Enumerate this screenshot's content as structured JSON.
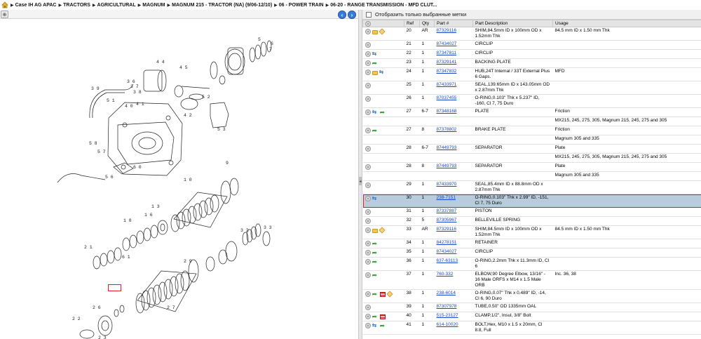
{
  "breadcrumb": [
    "Case IH AG APAC",
    "TRACTORS",
    "AGRICULTURAL",
    "MAGNUM",
    "MAGNUM 215 - TRACTOR (NA) (9/06-12/10)",
    "06 - POWER TRAIN",
    "06-20 - RANGE TRANSMISSION - MFD CLUT..."
  ],
  "filter": {
    "label": "Отобразить только выбранные метки",
    "checked": false
  },
  "columns": [
    "",
    "Ref",
    "Qty",
    "Part #",
    "Part Description",
    "Usage"
  ],
  "rows": [
    {
      "icons": [
        "gear-icon",
        "folder-icon",
        "box-icon"
      ],
      "ref": "20",
      "qty": "AR",
      "part": "87329116",
      "desc": "SHIM,84.5mm ID x 100mm OD x 1.52mm Thk",
      "usage": "84.5 mm ID x 1.50 mm Thk"
    },
    {
      "icons": [
        "gear-icon"
      ],
      "ref": "21",
      "qty": "1",
      "part": "87434027",
      "desc": "CIRCLIP",
      "usage": ""
    },
    {
      "icons": [
        "gear-icon",
        "swap-icon"
      ],
      "ref": "22",
      "qty": "1",
      "part": "87347811",
      "desc": "CIRCLIP",
      "usage": ""
    },
    {
      "icons": [
        "gear-icon",
        "arrow-icon"
      ],
      "ref": "23",
      "qty": "1",
      "part": "87329141",
      "desc": "BACKING PLATE",
      "usage": ""
    },
    {
      "icons": [
        "gear-icon",
        "folder-icon",
        "swap-icon"
      ],
      "ref": "24",
      "qty": "1",
      "part": "87347832",
      "desc": "HUB,24T Internal / 33T External Plus 6 Gaps.",
      "usage": "MFD"
    },
    {
      "icons": [
        "gear-icon"
      ],
      "ref": "25",
      "qty": "1",
      "part": "87433971",
      "desc": "SEAL,139.65mm ID x 143.05mm OD x 2.87mm Thk",
      "usage": ""
    },
    {
      "icons": [
        "gear-icon"
      ],
      "ref": "26",
      "qty": "1",
      "part": "87037455",
      "desc": "O-RING,0.103\" Thk x 5.237\" ID, -160, Cl 7, 75 Duro",
      "usage": ""
    },
    {
      "icons": [
        "gear-icon",
        "swap-icon",
        "arrow-icon"
      ],
      "ref": "27",
      "qty": "6-7",
      "part": "87348168",
      "desc": "PLATE",
      "usage": "Friction"
    },
    {
      "icons": [],
      "ref": "",
      "qty": "",
      "part": "",
      "desc": "",
      "usage": "MX215, 245, 275, 305, Magnum 215, 245, 275 and 305"
    },
    {
      "icons": [
        "gear-icon",
        "arrow-icon"
      ],
      "ref": "27",
      "qty": "8",
      "part": "87378802",
      "desc": "BRAKE PLATE",
      "usage": "Friction"
    },
    {
      "icons": [],
      "ref": "",
      "qty": "",
      "part": "",
      "desc": "",
      "usage": "Magnum 305 and 335"
    },
    {
      "icons": [
        "gear-icon"
      ],
      "ref": "28",
      "qty": "6-7",
      "part": "87449793",
      "desc": "SEPARATOR",
      "usage": "Plate"
    },
    {
      "icons": [],
      "ref": "",
      "qty": "",
      "part": "",
      "desc": "",
      "usage": "MX215, 245, 275, 305, Magnum 215, 245, 275 and 305"
    },
    {
      "icons": [
        "gear-icon"
      ],
      "ref": "28",
      "qty": "8",
      "part": "87449793",
      "desc": "SEPARATOR",
      "usage": "Plate"
    },
    {
      "icons": [],
      "ref": "",
      "qty": "",
      "part": "",
      "desc": "",
      "usage": "Magnum 305 and 335"
    },
    {
      "icons": [
        "gear-icon"
      ],
      "ref": "29",
      "qty": "1",
      "part": "87433970",
      "desc": "SEAL,85.4mm ID x 88.8mm OD x 2.87mm Thk",
      "usage": ""
    },
    {
      "icons": [
        "gear-icon",
        "swap-icon"
      ],
      "ref": "30",
      "qty": "1",
      "part": "238-7151",
      "desc": "O-RING,0.103\" Thk x 2.99\" ID, -151, Cl 7, 75 Duro",
      "usage": "",
      "selected": true
    },
    {
      "icons": [
        "gear-icon"
      ],
      "ref": "31",
      "qty": "1",
      "part": "87337887",
      "desc": "PISTON",
      "usage": ""
    },
    {
      "icons": [
        "gear-icon"
      ],
      "ref": "32",
      "qty": "5",
      "part": "87305967",
      "desc": "BELLEVILLE SPRING",
      "usage": ""
    },
    {
      "icons": [
        "gear-icon",
        "folder-icon",
        "box-icon"
      ],
      "ref": "33",
      "qty": "AR",
      "part": "87329116",
      "desc": "SHIM,84.5mm ID x 100mm OD x 1.52mm Thk",
      "usage": "84.5 mm ID x 1.50 mm Thk"
    },
    {
      "icons": [
        "gear-icon",
        "arrow-icon"
      ],
      "ref": "34",
      "qty": "1",
      "part": "84278151",
      "desc": "RETAINER",
      "usage": ""
    },
    {
      "icons": [
        "gear-icon",
        "arrow-icon"
      ],
      "ref": "35",
      "qty": "1",
      "part": "87434027",
      "desc": "CIRCLIP",
      "usage": ""
    },
    {
      "icons": [
        "gear-icon",
        "arrow-icon"
      ],
      "ref": "36",
      "qty": "1",
      "part": "637-63113",
      "desc": "O-RING,2.2mm Thk x 11.3mm ID, Cl 6",
      "usage": ""
    },
    {
      "icons": [
        "gear-icon",
        "arrow-icon"
      ],
      "ref": "37",
      "qty": "1",
      "part": "760-332",
      "desc": "ELBOW,90 Degree Elbow, 13/16\" - 16 Male ORFS x M14 x 1.5 Male ORB",
      "usage": "Inc. 36, 38"
    },
    {
      "icons": [
        "gear-icon",
        "arrow-icon",
        "flag-icon",
        "box-icon"
      ],
      "ref": "38",
      "qty": "1",
      "part": "238-6014",
      "desc": "O-RING,0.07\" Thk x 0.489\" ID, -14, Cl 6, 90 Duro",
      "usage": ""
    },
    {
      "icons": [
        "gear-icon"
      ],
      "ref": "39",
      "qty": "1",
      "part": "87307978",
      "desc": "TUBE,0.50\" OD 1335mm OAL",
      "usage": ""
    },
    {
      "icons": [
        "gear-icon",
        "arrow-icon",
        "flag-icon"
      ],
      "ref": "40",
      "qty": "1",
      "part": "515-23127",
      "desc": "CLAMP,1/2\", Insul, 3/8\" Bolt",
      "usage": ""
    },
    {
      "icons": [
        "gear-icon",
        "swap-icon",
        "arrow-icon"
      ],
      "ref": "41",
      "qty": "1",
      "part": "614-10020",
      "desc": "BOLT,Hex, M10 x 1.5 x 20mm, Cl 8.8, Full",
      "usage": ""
    }
  ],
  "diagram_labels": [
    {
      "t": "5",
      "k": "a"
    },
    {
      "t": "6",
      "k": "b"
    },
    {
      "t": "7",
      "k": "c"
    },
    {
      "t": "4 4",
      "k": "d"
    },
    {
      "t": "4 5",
      "k": "e"
    },
    {
      "t": "3 9",
      "k": "f"
    },
    {
      "t": "3 6",
      "k": "g"
    },
    {
      "t": "3 7",
      "k": "h"
    },
    {
      "t": "3 8",
      "k": "i"
    },
    {
      "t": "5 1",
      "k": "j"
    },
    {
      "t": "4 0",
      "k": "k"
    },
    {
      "t": "4 1",
      "k": "l"
    },
    {
      "t": "5 8",
      "k": "m"
    },
    {
      "t": "5 7",
      "k": "n"
    },
    {
      "t": "5 6",
      "k": "o"
    },
    {
      "t": "6 0",
      "k": "p"
    },
    {
      "t": "5 2",
      "k": "q"
    },
    {
      "t": "4 2",
      "k": "r"
    },
    {
      "t": "5 3",
      "k": "s"
    },
    {
      "t": "9",
      "k": "t"
    },
    {
      "t": "1 0",
      "k": "u"
    },
    {
      "t": "1 3",
      "k": "v"
    },
    {
      "t": "1 6",
      "k": "w"
    },
    {
      "t": "1 8",
      "k": "x"
    },
    {
      "t": "2 1",
      "k": "y"
    },
    {
      "t": "6 1",
      "k": "z"
    },
    {
      "t": "3 2",
      "k": "aa"
    },
    {
      "t": "3 3",
      "k": "ab"
    },
    {
      "t": "2 6",
      "k": "ac"
    },
    {
      "t": "2 2",
      "k": "ad"
    },
    {
      "t": "2 3",
      "k": "ae"
    },
    {
      "t": "2 7",
      "k": "af"
    },
    {
      "t": "2 9",
      "k": "ag"
    }
  ]
}
